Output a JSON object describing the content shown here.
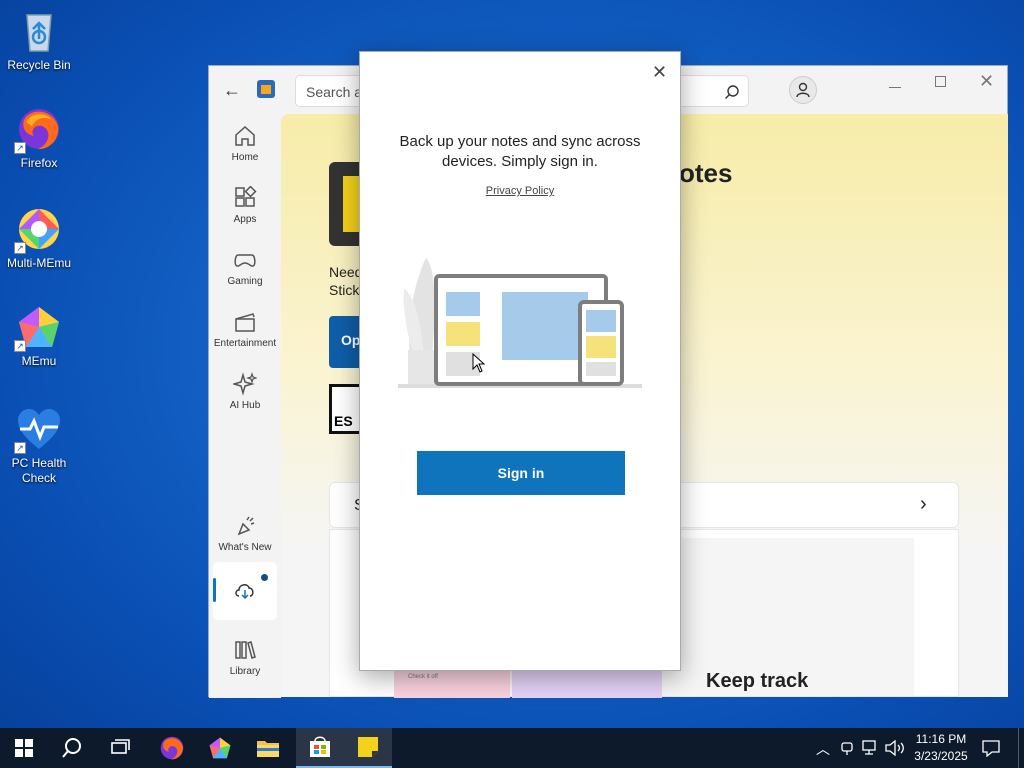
{
  "desktop": {
    "icons": [
      {
        "label": "Recycle Bin"
      },
      {
        "label": "Firefox"
      },
      {
        "label": "Multi-MEmu"
      },
      {
        "label": "MEmu"
      },
      {
        "label": "PC Health\nCheck"
      }
    ]
  },
  "store": {
    "search_placeholder": "Search ap",
    "nav": [
      {
        "label": "Home",
        "icon": "home-icon"
      },
      {
        "label": "Apps",
        "icon": "apps-icon"
      },
      {
        "label": "Gaming",
        "icon": "gaming-icon"
      },
      {
        "label": "Entertainment",
        "icon": "entertainment-icon"
      },
      {
        "label": "AI Hub",
        "icon": "ai-hub-icon"
      },
      {
        "label": "What's New",
        "icon": "whats-new-icon"
      },
      {
        "label": "Library",
        "icon": "library-icon"
      }
    ],
    "app_title_fragment": "otes",
    "desc_line1": "Need",
    "desc_line2": "Sticky",
    "open_btn_fragment": "Op",
    "esrb_fragment": "ES",
    "section_fragment": "S",
    "keep_track": "Keep track",
    "thumb_caption": "Check it off"
  },
  "dialog": {
    "message": "Back up your notes and sync across devices. Simply sign in.",
    "privacy": "Privacy Policy",
    "signin": "Sign in"
  },
  "taskbar": {
    "time": "11:16 PM",
    "date": "3/23/2025"
  },
  "colors": {
    "accent": "#0f74bb",
    "desktop": "#1565c8",
    "taskbar": "#0d1a2c"
  }
}
